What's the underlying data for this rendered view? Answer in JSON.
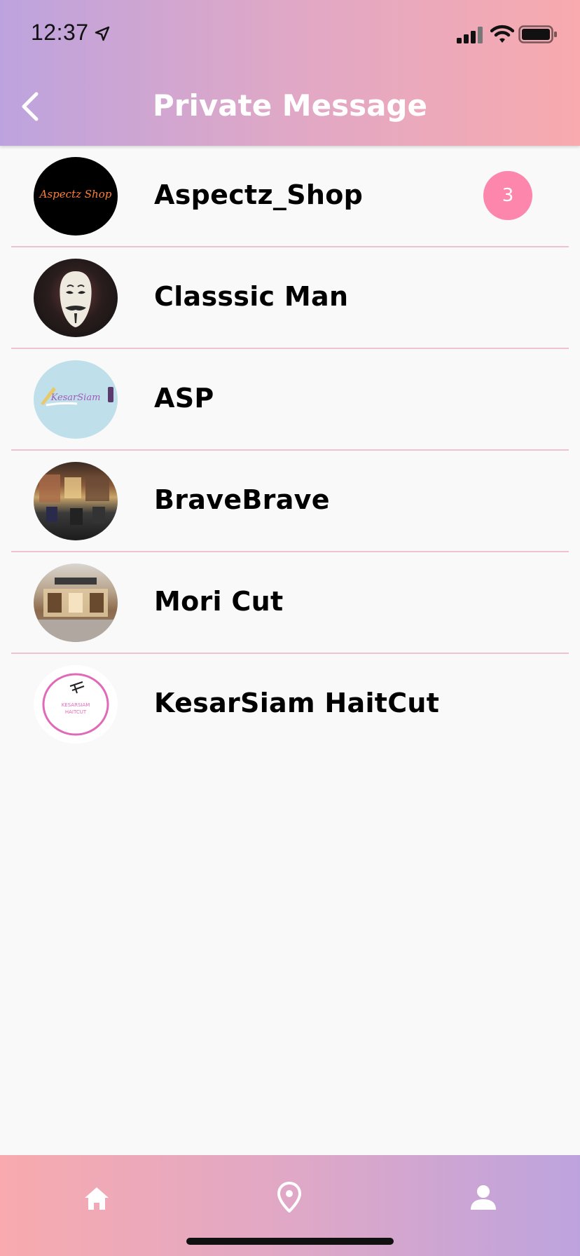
{
  "status_bar": {
    "time": "12:37",
    "icons": [
      "location-arrow-icon",
      "cellular-signal-icon",
      "wifi-icon",
      "battery-icon"
    ]
  },
  "header": {
    "title": "Private Message",
    "back_icon": "chevron-left-icon"
  },
  "conversations": [
    {
      "name": "Aspectz_Shop",
      "unread": "3",
      "avatar_text": "Aspectz Shop"
    },
    {
      "name": "Classsic Man"
    },
    {
      "name": "ASP",
      "avatar_text": "KesarSiam"
    },
    {
      "name": "BraveBrave"
    },
    {
      "name": "Mori Cut"
    },
    {
      "name": "KesarSiam HaitCut",
      "avatar_text": "KESARSIAM HAITCUT"
    }
  ],
  "bottom_nav": {
    "items": [
      "home-icon",
      "map-pin-icon",
      "profile-icon"
    ]
  },
  "colors": {
    "header_gradient": [
      "#bda3de",
      "#f8aaae"
    ],
    "badge": "#fc86ac",
    "divider": "#f0c2cf"
  }
}
